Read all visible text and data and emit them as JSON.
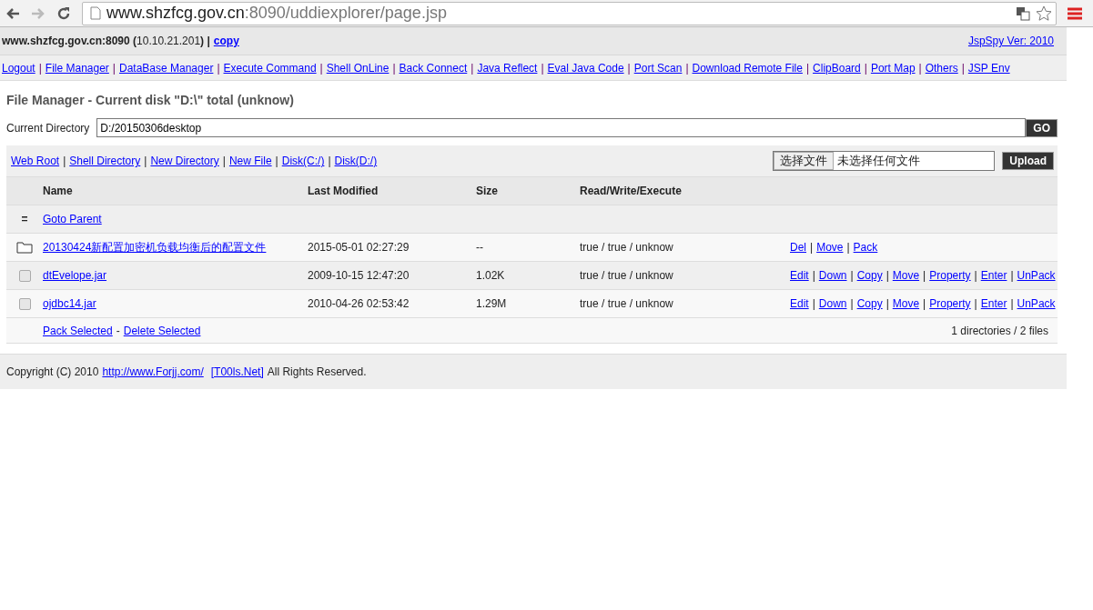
{
  "browser": {
    "url_host": "www.shzfcg.gov.cn",
    "url_rest": ":8090/uddiexplorer/page.jsp"
  },
  "header": {
    "host": "**www.shzfcg.gov.cn:8090 (**10.10.21.201**) |**",
    "copy_link": "copy",
    "version_link": "JspSpy Ver: 2010"
  },
  "nav": {
    "separator": "|",
    "links": [
      "Logout",
      "File Manager",
      "DataBase Manager",
      "Execute Command",
      "Shell OnLine",
      "Back Connect",
      "Java Reflect",
      "Eval Java Code",
      "Port Scan",
      "Download Remote File",
      "ClipBoard",
      "Port Map",
      "Others",
      "JSP Env"
    ]
  },
  "title": "File Manager - Current disk \"D:\\\" total (unknow)",
  "directory": {
    "label": "Current Directory",
    "value": "D:/20150306desktop",
    "button": "GO"
  },
  "toolbar": {
    "separator": "|",
    "links": [
      "Web Root",
      "Shell Directory",
      "New Directory",
      "New File",
      "Disk(C:/)",
      "Disk(D:/)"
    ],
    "choose_button": "选择文件",
    "no_file": "未选择任何文件",
    "upload_button": "Upload"
  },
  "table": {
    "columns": [
      "Name",
      "Last Modified",
      "Size",
      "Read/Write/Execute"
    ],
    "rows": [
      {
        "kind": "parent",
        "icon_text": "=",
        "name": "Goto Parent"
      },
      {
        "kind": "dir",
        "name": "20130424新配置加密机负载均衡后的配置文件",
        "modified": "2015-05-01 02:27:29",
        "size": "--",
        "rwx": "true / true / unknow",
        "actions": [
          "Del",
          "Move",
          "Pack"
        ]
      },
      {
        "kind": "file",
        "checked": false,
        "name": "dtEvelope.jar",
        "modified": "2009-10-15 12:47:20",
        "size": "1.02K",
        "rwx": "true / true / unknow",
        "actions": [
          "Edit",
          "Down",
          "Copy",
          "Move",
          "Property",
          "Enter",
          "UnPack"
        ]
      },
      {
        "kind": "file",
        "checked": false,
        "name": "ojdbc14.jar",
        "modified": "2010-04-26 02:53:42",
        "size": "1.29M",
        "rwx": "true / true / unknow",
        "actions": [
          "Edit",
          "Down",
          "Copy",
          "Move",
          "Property",
          "Enter",
          "UnPack"
        ]
      }
    ],
    "footer": {
      "pack": "Pack Selected",
      "dash": "-",
      "delete": "Delete Selected",
      "summary": "1 directories / 2 files"
    }
  },
  "copyright": {
    "prefix": "Copyright (C) 2010",
    "link1": "http://www.Forjj.com/",
    "link2": "[T00ls.Net]",
    "suffix": "All Rights Reserved."
  }
}
